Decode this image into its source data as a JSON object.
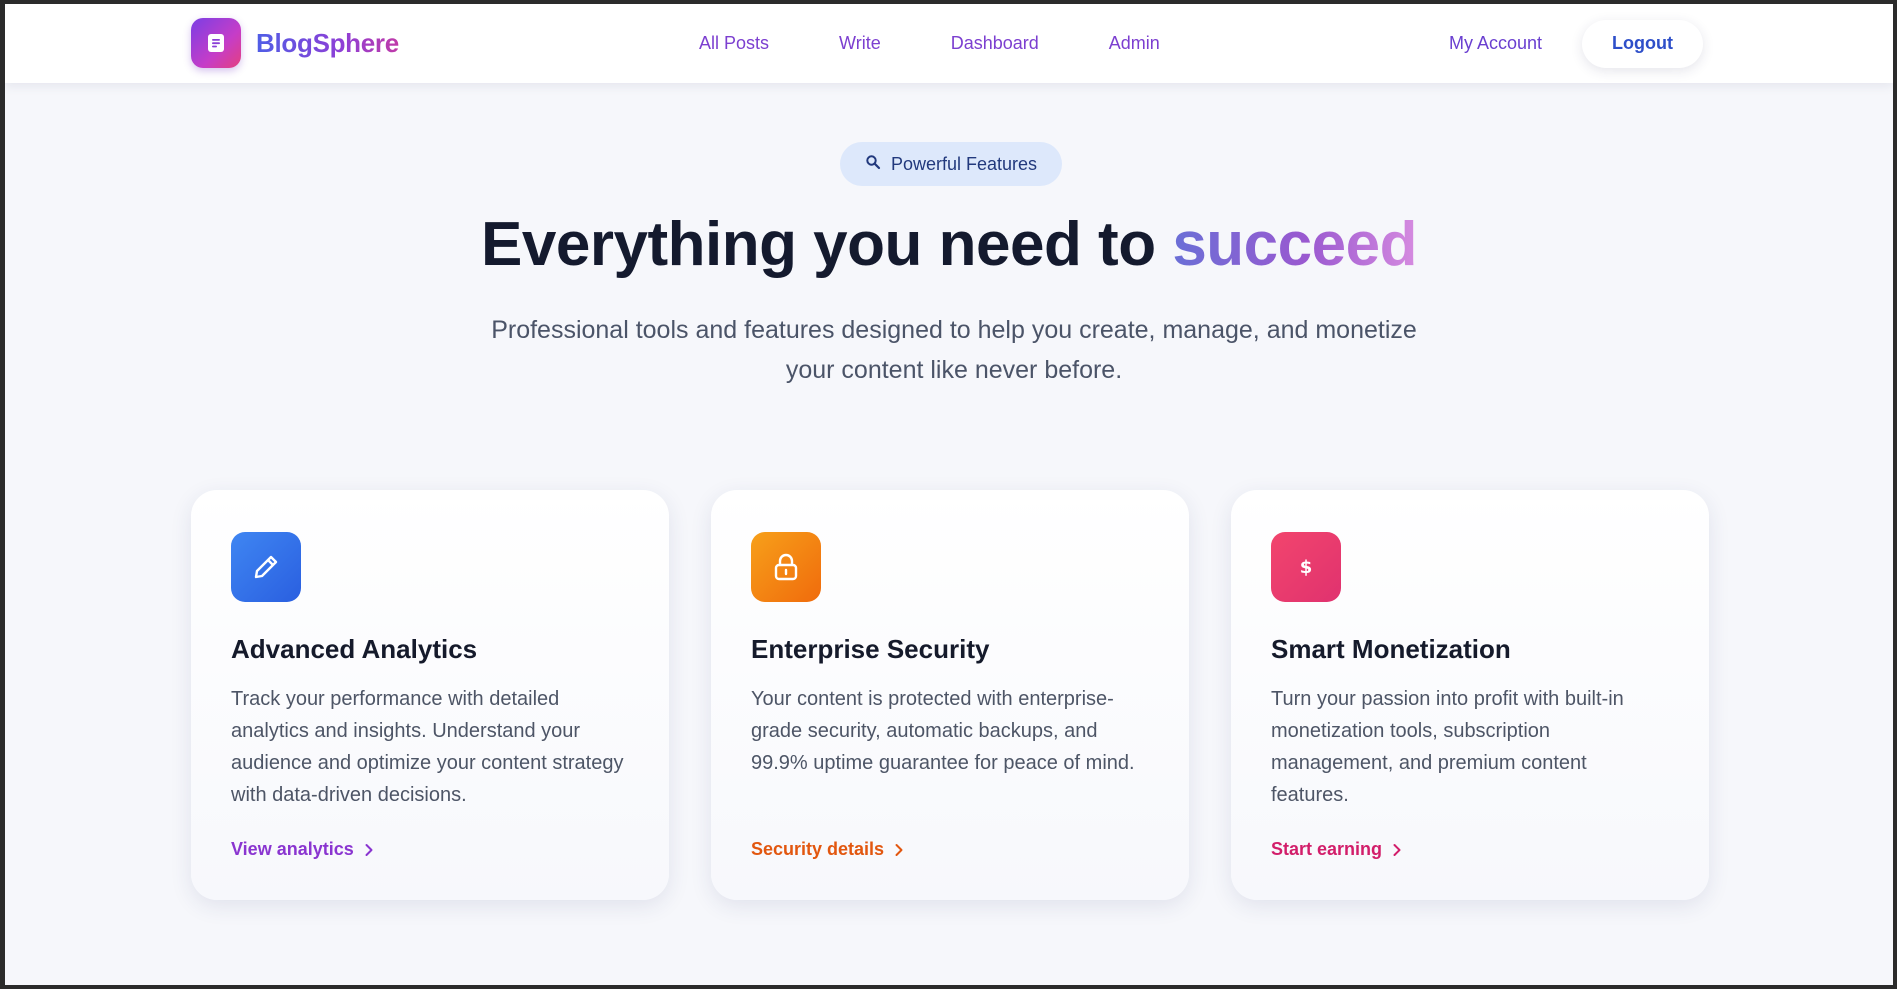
{
  "brand": {
    "name": "BlogSphere",
    "icon": "document-icon"
  },
  "nav": {
    "links": [
      "All Posts",
      "Write",
      "Dashboard",
      "Admin"
    ],
    "account": "My Account",
    "logout": "Logout"
  },
  "hero": {
    "badge": {
      "icon": "search-icon",
      "label": "Powerful Features"
    },
    "title_main": "Everything you need to ",
    "title_accent": "succeed",
    "subtitle": "Professional tools and features designed to help you create, manage, and monetize your content like never before."
  },
  "features": [
    {
      "icon": "pencil-icon",
      "color": "#2e6fe8",
      "title": "Advanced Analytics",
      "description": "Track your performance with detailed analytics and insights. Understand your audience and optimize your content strategy with data-driven decisions.",
      "link": "View analytics",
      "link_color": "#8a35d0"
    },
    {
      "icon": "lock-icon",
      "color": "#f5820d",
      "title": "Enterprise Security",
      "description": "Your content is protected with enterprise-grade security, automatic backups, and 99.9% uptime guarantee for peace of mind.",
      "link": "Security details",
      "link_color": "#e2570f"
    },
    {
      "icon": "dollar-icon",
      "color": "#ec3a6c",
      "title": "Smart Monetization",
      "description": "Turn your passion into profit with built-in monetization tools, subscription management, and premium content features.",
      "link": "Start earning",
      "link_color": "#d21e6a"
    }
  ]
}
